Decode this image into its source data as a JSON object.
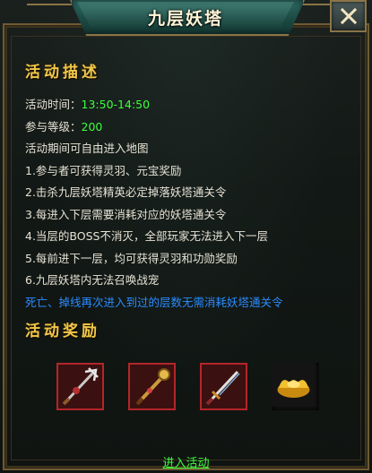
{
  "window": {
    "title": "九层妖塔"
  },
  "description": {
    "heading": "活动描述",
    "time_label": "活动时间：",
    "time_value": "13:50-14:50",
    "level_label": "参与等级：",
    "level_value": "200",
    "lines": [
      "活动期间可自由进入地图",
      "1.参与者可获得灵羽、元宝奖励",
      "2.击杀九层妖塔精英必定掉落妖塔通关令",
      "3.每进入下层需要消耗对应的妖塔通关令",
      "4.当层的BOSS不消灭，全部玩家无法进入下一层",
      "5.每前进下一层，均可获得灵羽和功勋奖励",
      "6.九层妖塔内无法召唤战宠"
    ],
    "notice": "死亡、掉线再次进入到过的层数无需消耗妖塔通关令"
  },
  "rewards": {
    "heading": "活动奖励",
    "items": [
      {
        "icon": "trident-weapon-icon"
      },
      {
        "icon": "staff-weapon-icon"
      },
      {
        "icon": "sword-weapon-icon"
      },
      {
        "icon": "gold-ingot-icon"
      }
    ]
  },
  "actions": {
    "enter_label": "进入活动"
  },
  "colors": {
    "accent_gold": "#f0c84a",
    "value_green": "#3dff3d",
    "notice_blue": "#2a8cff",
    "frame_bronze": "#8a7447"
  }
}
